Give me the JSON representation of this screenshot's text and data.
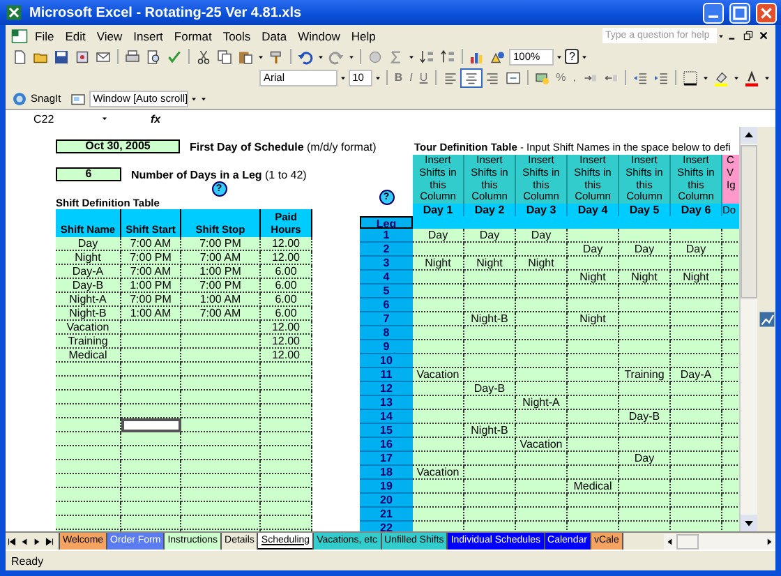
{
  "window": {
    "title": "Microsoft Excel - Rotating-25 Ver 4.81.xls"
  },
  "menu": [
    "File",
    "Edit",
    "View",
    "Insert",
    "Format",
    "Tools",
    "Data",
    "Window",
    "Help"
  ],
  "help_search": {
    "placeholder": "Type a question for help"
  },
  "standard_toolbar": {
    "zoom": "100%",
    "help": "?"
  },
  "formatting_toolbar": {
    "font": "Arial",
    "size": "10",
    "style_buttons": [
      "B",
      "I",
      "U"
    ],
    "align_buttons": [
      {
        "selected": false
      },
      {
        "selected": true
      },
      {
        "selected": false
      }
    ],
    "number_buttons": [
      "%",
      ","
    ]
  },
  "snagit_toolbar": {
    "label": "SnagIt",
    "window_mode": "Window [Auto scroll]"
  },
  "formula_bar": {
    "name_box": "C22",
    "function_label": "fx"
  },
  "sheet": {
    "start_date": {
      "value": "Oct 30, 2005",
      "label": "**First Day of Schedule** (m/d/y format)"
    },
    "leg_days": {
      "value": "6",
      "label": "**Number of Days in a Leg** (1 to 42)"
    },
    "shift_table": {
      "title": "Shift Definition Table",
      "help": "?",
      "columns": [
        "Shift Name",
        "Shift Start",
        "Shift Stop",
        "Paid Hours"
      ],
      "rows": [
        {
          "cells": [
            {
              "kind": "text",
              "text": "Day"
            },
            {
              "kind": "text",
              "text": "7:00 AM"
            },
            {
              "kind": "text",
              "text": "7:00 PM"
            },
            {
              "kind": "text",
              "text": "12.00"
            }
          ],
          "selected": false
        },
        {
          "cells": [
            {
              "kind": "text",
              "text": "Night"
            },
            {
              "kind": "text",
              "text": "7:00 PM"
            },
            {
              "kind": "text",
              "text": "7:00 AM"
            },
            {
              "kind": "text",
              "text": "12.00"
            }
          ],
          "selected": false
        },
        {
          "cells": [
            {
              "kind": "text",
              "text": "Day-A"
            },
            {
              "kind": "text",
              "text": "7:00 AM"
            },
            {
              "kind": "text",
              "text": "1:00 PM"
            },
            {
              "kind": "text",
              "text": "6.00"
            }
          ],
          "selected": false
        },
        {
          "cells": [
            {
              "kind": "text",
              "text": "Day-B"
            },
            {
              "kind": "text",
              "text": "1:00 PM"
            },
            {
              "kind": "text",
              "text": "7:00 PM"
            },
            {
              "kind": "text",
              "text": "6.00"
            }
          ],
          "selected": false
        },
        {
          "cells": [
            {
              "kind": "text",
              "text": "Night-A"
            },
            {
              "kind": "text",
              "text": "7:00 PM"
            },
            {
              "kind": "text",
              "text": "1:00 AM"
            },
            {
              "kind": "text",
              "text": "6.00"
            }
          ],
          "selected": false
        },
        {
          "cells": [
            {
              "kind": "text",
              "text": "Night-B"
            },
            {
              "kind": "text",
              "text": "1:00 AM"
            },
            {
              "kind": "text",
              "text": "7:00 AM"
            },
            {
              "kind": "text",
              "text": "6.00"
            }
          ],
          "selected": false
        },
        {
          "cells": [
            {
              "kind": "text",
              "text": "Vacation"
            },
            {
              "kind": "empty"
            },
            {
              "kind": "empty"
            },
            {
              "kind": "text",
              "text": "12.00"
            }
          ],
          "selected": false
        },
        {
          "cells": [
            {
              "kind": "text",
              "text": "Training"
            },
            {
              "kind": "empty"
            },
            {
              "kind": "empty"
            },
            {
              "kind": "text",
              "text": "12.00"
            }
          ],
          "selected": false
        },
        {
          "cells": [
            {
              "kind": "text",
              "text": "Medical"
            },
            {
              "kind": "empty"
            },
            {
              "kind": "empty"
            },
            {
              "kind": "text",
              "text": "12.00"
            }
          ],
          "selected": false
        },
        {
          "cells": [
            {
              "kind": "empty"
            },
            {
              "kind": "empty"
            },
            {
              "kind": "empty"
            },
            {
              "kind": "empty"
            }
          ],
          "selected": false
        },
        {
          "cells": [
            {
              "kind": "empty"
            },
            {
              "kind": "empty"
            },
            {
              "kind": "empty"
            },
            {
              "kind": "empty"
            }
          ],
          "selected": false
        },
        {
          "cells": [
            {
              "kind": "empty"
            },
            {
              "kind": "empty"
            },
            {
              "kind": "empty"
            },
            {
              "kind": "empty"
            }
          ],
          "selected": false
        },
        {
          "cells": [
            {
              "kind": "empty"
            },
            {
              "kind": "empty"
            },
            {
              "kind": "empty"
            },
            {
              "kind": "empty"
            }
          ],
          "selected": false
        },
        {
          "cells": [
            {
              "kind": "empty"
            },
            {
              "kind": "empty"
            },
            {
              "kind": "empty"
            },
            {
              "kind": "empty"
            }
          ],
          "selected": true
        },
        {
          "cells": [
            {
              "kind": "empty"
            },
            {
              "kind": "empty"
            },
            {
              "kind": "empty"
            },
            {
              "kind": "empty"
            }
          ],
          "selected": false
        },
        {
          "cells": [
            {
              "kind": "empty"
            },
            {
              "kind": "empty"
            },
            {
              "kind": "empty"
            },
            {
              "kind": "empty"
            }
          ],
          "selected": false
        },
        {
          "cells": [
            {
              "kind": "empty"
            },
            {
              "kind": "empty"
            },
            {
              "kind": "empty"
            },
            {
              "kind": "empty"
            }
          ],
          "selected": false
        },
        {
          "cells": [
            {
              "kind": "empty"
            },
            {
              "kind": "empty"
            },
            {
              "kind": "empty"
            },
            {
              "kind": "empty"
            }
          ],
          "selected": false
        },
        {
          "cells": [
            {
              "kind": "empty"
            },
            {
              "kind": "empty"
            },
            {
              "kind": "empty"
            },
            {
              "kind": "empty"
            }
          ],
          "selected": false
        },
        {
          "cells": [
            {
              "kind": "empty"
            },
            {
              "kind": "empty"
            },
            {
              "kind": "empty"
            },
            {
              "kind": "empty"
            }
          ],
          "selected": false
        },
        {
          "cells": [
            {
              "kind": "empty"
            },
            {
              "kind": "empty"
            },
            {
              "kind": "empty"
            },
            {
              "kind": "empty"
            }
          ],
          "selected": false
        },
        {
          "cells": [
            {
              "kind": "empty"
            },
            {
              "kind": "empty"
            },
            {
              "kind": "empty"
            },
            {
              "kind": "empty"
            }
          ],
          "selected": false
        }
      ]
    },
    "tour_table": {
      "title": "**Tour Definition Table** - Input Shift Names in the space below to defi",
      "help": "?",
      "leg_header": "Leg",
      "columns": [
        {
          "note": "Insert Shifts in this Column",
          "day": "Day 1"
        },
        {
          "note": "Insert Shifts in this Column",
          "day": "Day 2"
        },
        {
          "note": "Insert Shifts in this Column",
          "day": "Day 3"
        },
        {
          "note": "Insert Shifts in this Column",
          "day": "Day 4"
        },
        {
          "note": "Insert Shifts in this Column",
          "day": "Day 5"
        },
        {
          "note": "Insert Shifts in this Column",
          "day": "Day 6"
        }
      ],
      "cut_column": {
        "note_lines": [
          "C",
          "V",
          "Ig"
        ],
        "day": "Do"
      },
      "legs": [
        {
          "leg": "1",
          "shifts": [
            {
              "kind": "text",
              "text": "Day"
            },
            {
              "kind": "text",
              "text": "Day"
            },
            {
              "kind": "text",
              "text": "Day"
            },
            {
              "kind": "empty"
            },
            {
              "kind": "empty"
            },
            {
              "kind": "empty"
            }
          ]
        },
        {
          "leg": "2",
          "shifts": [
            {
              "kind": "empty"
            },
            {
              "kind": "empty"
            },
            {
              "kind": "empty"
            },
            {
              "kind": "text",
              "text": "Day"
            },
            {
              "kind": "text",
              "text": "Day"
            },
            {
              "kind": "text",
              "text": "Day"
            }
          ]
        },
        {
          "leg": "3",
          "shifts": [
            {
              "kind": "text",
              "text": "Night"
            },
            {
              "kind": "text",
              "text": "Night"
            },
            {
              "kind": "text",
              "text": "Night"
            },
            {
              "kind": "empty"
            },
            {
              "kind": "empty"
            },
            {
              "kind": "empty"
            }
          ]
        },
        {
          "leg": "4",
          "shifts": [
            {
              "kind": "empty"
            },
            {
              "kind": "empty"
            },
            {
              "kind": "empty"
            },
            {
              "kind": "text",
              "text": "Night"
            },
            {
              "kind": "text",
              "text": "Night"
            },
            {
              "kind": "text",
              "text": "Night"
            }
          ]
        },
        {
          "leg": "5",
          "shifts": [
            {
              "kind": "empty"
            },
            {
              "kind": "empty"
            },
            {
              "kind": "empty"
            },
            {
              "kind": "empty"
            },
            {
              "kind": "empty"
            },
            {
              "kind": "empty"
            }
          ]
        },
        {
          "leg": "6",
          "shifts": [
            {
              "kind": "empty"
            },
            {
              "kind": "empty"
            },
            {
              "kind": "empty"
            },
            {
              "kind": "empty"
            },
            {
              "kind": "empty"
            },
            {
              "kind": "empty"
            }
          ]
        },
        {
          "leg": "7",
          "shifts": [
            {
              "kind": "empty"
            },
            {
              "kind": "text",
              "text": "Night-B"
            },
            {
              "kind": "empty"
            },
            {
              "kind": "text",
              "text": "Night"
            },
            {
              "kind": "empty"
            },
            {
              "kind": "empty"
            }
          ]
        },
        {
          "leg": "8",
          "shifts": [
            {
              "kind": "empty"
            },
            {
              "kind": "empty"
            },
            {
              "kind": "empty"
            },
            {
              "kind": "empty"
            },
            {
              "kind": "empty"
            },
            {
              "kind": "empty"
            }
          ]
        },
        {
          "leg": "9",
          "shifts": [
            {
              "kind": "empty"
            },
            {
              "kind": "empty"
            },
            {
              "kind": "empty"
            },
            {
              "kind": "empty"
            },
            {
              "kind": "empty"
            },
            {
              "kind": "empty"
            }
          ]
        },
        {
          "leg": "10",
          "shifts": [
            {
              "kind": "empty"
            },
            {
              "kind": "empty"
            },
            {
              "kind": "empty"
            },
            {
              "kind": "empty"
            },
            {
              "kind": "empty"
            },
            {
              "kind": "empty"
            }
          ]
        },
        {
          "leg": "11",
          "shifts": [
            {
              "kind": "text",
              "text": "Vacation"
            },
            {
              "kind": "empty"
            },
            {
              "kind": "empty"
            },
            {
              "kind": "empty"
            },
            {
              "kind": "text",
              "text": "Training"
            },
            {
              "kind": "text",
              "text": "Day-A"
            }
          ]
        },
        {
          "leg": "12",
          "shifts": [
            {
              "kind": "empty"
            },
            {
              "kind": "text",
              "text": "Day-B"
            },
            {
              "kind": "empty"
            },
            {
              "kind": "empty"
            },
            {
              "kind": "empty"
            },
            {
              "kind": "empty"
            }
          ]
        },
        {
          "leg": "13",
          "shifts": [
            {
              "kind": "empty"
            },
            {
              "kind": "empty"
            },
            {
              "kind": "text",
              "text": "Night-A"
            },
            {
              "kind": "empty"
            },
            {
              "kind": "empty"
            },
            {
              "kind": "empty"
            }
          ]
        },
        {
          "leg": "14",
          "shifts": [
            {
              "kind": "empty"
            },
            {
              "kind": "empty"
            },
            {
              "kind": "empty"
            },
            {
              "kind": "empty"
            },
            {
              "kind": "text",
              "text": "Day-B"
            },
            {
              "kind": "empty"
            }
          ]
        },
        {
          "leg": "15",
          "shifts": [
            {
              "kind": "empty"
            },
            {
              "kind": "text",
              "text": "Night-B"
            },
            {
              "kind": "empty"
            },
            {
              "kind": "empty"
            },
            {
              "kind": "empty"
            },
            {
              "kind": "empty"
            }
          ]
        },
        {
          "leg": "16",
          "shifts": [
            {
              "kind": "empty"
            },
            {
              "kind": "empty"
            },
            {
              "kind": "text",
              "text": "Vacation"
            },
            {
              "kind": "empty"
            },
            {
              "kind": "empty"
            },
            {
              "kind": "empty"
            }
          ]
        },
        {
          "leg": "17",
          "shifts": [
            {
              "kind": "empty"
            },
            {
              "kind": "empty"
            },
            {
              "kind": "empty"
            },
            {
              "kind": "empty"
            },
            {
              "kind": "text",
              "text": "Day"
            },
            {
              "kind": "empty"
            }
          ]
        },
        {
          "leg": "18",
          "shifts": [
            {
              "kind": "text",
              "text": "Vacation"
            },
            {
              "kind": "empty"
            },
            {
              "kind": "empty"
            },
            {
              "kind": "empty"
            },
            {
              "kind": "empty"
            },
            {
              "kind": "empty"
            }
          ]
        },
        {
          "leg": "19",
          "shifts": [
            {
              "kind": "empty"
            },
            {
              "kind": "empty"
            },
            {
              "kind": "empty"
            },
            {
              "kind": "text",
              "text": "Medical"
            },
            {
              "kind": "empty"
            },
            {
              "kind": "empty"
            }
          ]
        },
        {
          "leg": "20",
          "shifts": [
            {
              "kind": "empty"
            },
            {
              "kind": "empty"
            },
            {
              "kind": "empty"
            },
            {
              "kind": "empty"
            },
            {
              "kind": "empty"
            },
            {
              "kind": "empty"
            }
          ]
        },
        {
          "leg": "21",
          "shifts": [
            {
              "kind": "empty"
            },
            {
              "kind": "empty"
            },
            {
              "kind": "empty"
            },
            {
              "kind": "empty"
            },
            {
              "kind": "empty"
            },
            {
              "kind": "empty"
            }
          ]
        },
        {
          "leg": "22",
          "shifts": [
            {
              "kind": "empty"
            },
            {
              "kind": "empty"
            },
            {
              "kind": "empty"
            },
            {
              "kind": "empty"
            },
            {
              "kind": "empty"
            },
            {
              "kind": "empty"
            }
          ]
        }
      ]
    }
  },
  "sheet_tabs": [
    {
      "label": "Welcome",
      "color": "#f4a460",
      "selected": false
    },
    {
      "label": "Order Form",
      "color": "#5b7cf0",
      "selected": false
    },
    {
      "label": "Instructions",
      "color": "#ccffcc",
      "selected": false
    },
    {
      "label": "Details",
      "color": "#ece9d8",
      "selected": false
    },
    {
      "label": "Scheduling",
      "color": "#ffffff",
      "selected": true
    },
    {
      "label": "Vacations, etc",
      "color": "#33cccc",
      "selected": false
    },
    {
      "label": "Unfilled Shifts",
      "color": "#33cccc",
      "selected": false
    },
    {
      "label": "Individual Schedules",
      "color": "#0000ff",
      "selected": false
    },
    {
      "label": "Calendar",
      "color": "#0000ff",
      "selected": false
    },
    {
      "label": "vCale",
      "color": "#f4a460",
      "selected": false
    }
  ],
  "status_bar": "Ready"
}
